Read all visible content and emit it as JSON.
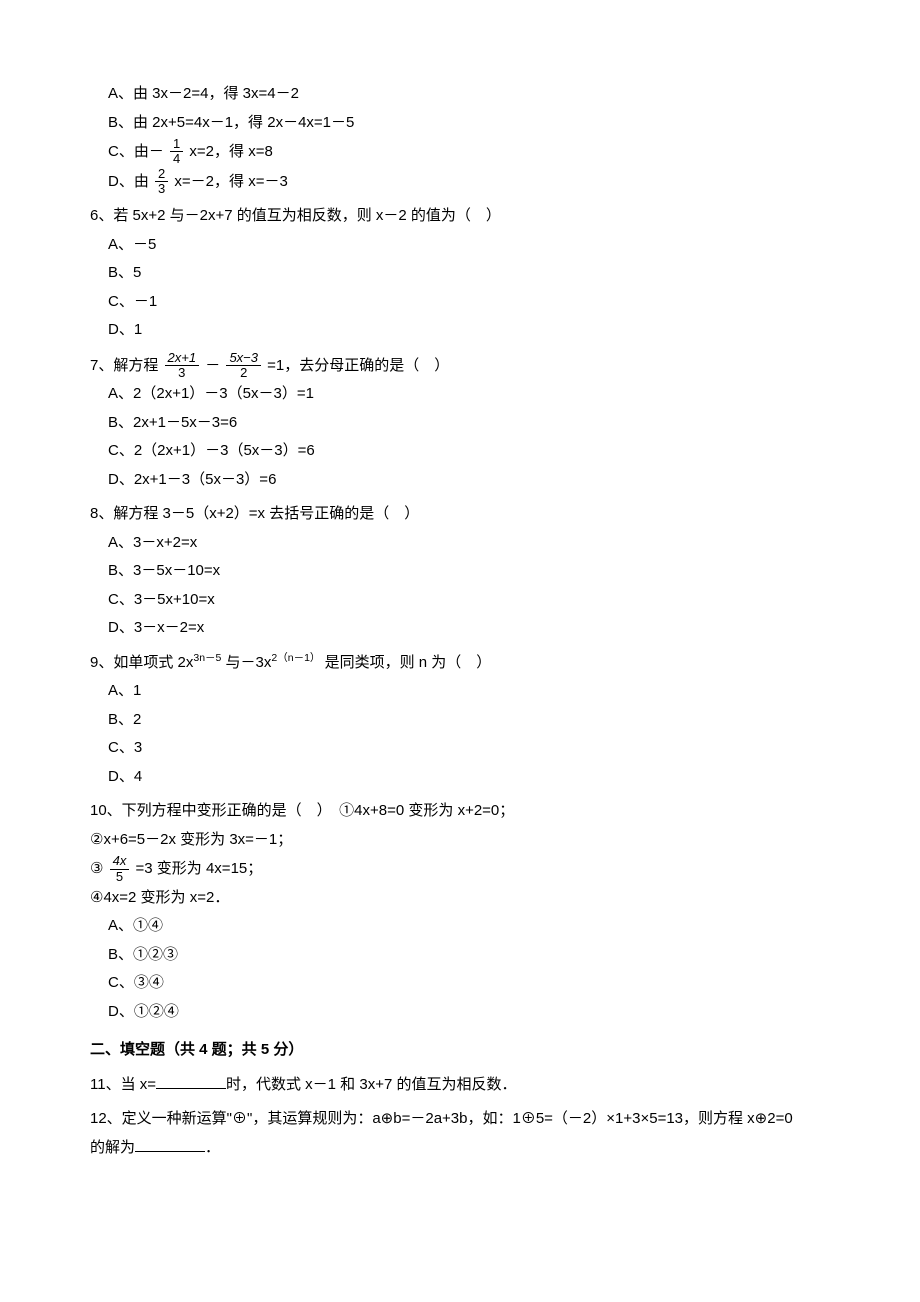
{
  "q5": {
    "opts": {
      "a": "A、由 3x－2=4，得 3x=4－2",
      "b": "B、由 2x+5=4x－1，得 2x－4x=1－5",
      "c_pre": "C、由－",
      "c_num": "1",
      "c_den": "4",
      "c_post": " x=2，得 x=8",
      "d_pre": "D、由 ",
      "d_num": "2",
      "d_den": "3",
      "d_post": " x=－2，得 x=－3"
    }
  },
  "q6": {
    "text": "6、若 5x+2 与－2x+7 的值互为相反数，则 x－2 的值为（　）",
    "opts": {
      "a": "A、－5",
      "b": "B、5",
      "c": "C、－1",
      "d": "D、1"
    }
  },
  "q7": {
    "pre": "7、解方程 ",
    "f1n": "2x+1",
    "f1d": "3",
    "mid1": "－",
    "f2n": "5x−3",
    "f2d": "2",
    "post": " =1，去分母正确的是（　）",
    "opts": {
      "a": "A、2（2x+1）－3（5x－3）=1",
      "b": "B、2x+1－5x－3=6",
      "c": "C、2（2x+1）－3（5x－3）=6",
      "d": "D、2x+1－3（5x－3）=6"
    }
  },
  "q8": {
    "text": "8、解方程 3－5（x+2）=x 去括号正确的是（　）",
    "opts": {
      "a": "A、3－x+2=x",
      "b": "B、3－5x－10=x",
      "c": "C、3－5x+10=x",
      "d": "D、3－x－2=x"
    }
  },
  "q9": {
    "pre": "9、如单项式 2x",
    "exp1": "3n－5",
    "mid": " 与－3x",
    "exp2": "2（n－1）",
    "post": " 是同类项，则 n 为（　）",
    "opts": {
      "a": "A、1",
      "b": "B、2",
      "c": "C、3",
      "d": "D、4"
    }
  },
  "q10": {
    "text": "10、下列方程中变形正确的是（　）　①4x+8=0 变形为 x+2=0；",
    "line2": "②x+6=5－2x 变形为 3x=－1；",
    "line3pre": "③ ",
    "f1n": "4x",
    "f1d": "5",
    "line3post": " =3 变形为 4x=15；",
    "line4": "④4x=2 变形为 x=2．",
    "opts": {
      "a": "A、①④",
      "b": "B、①②③",
      "c": "C、③④",
      "d": "D、①②④"
    }
  },
  "section2": "二、填空题（共 4 题；共 5 分）",
  "q11": {
    "pre": "11、当 x=",
    "post": "时，代数式 x－1 和 3x+7 的值互为相反数．"
  },
  "q12": {
    "pre": "12、定义一种新运算\"⊕\"，其运算规则为：a⊕b=－2a+3b，如：1⊕5=（－2）×1+3×5=13，则方程 x⊕2=0",
    "line2pre": "的解为",
    "line2post": "．"
  }
}
